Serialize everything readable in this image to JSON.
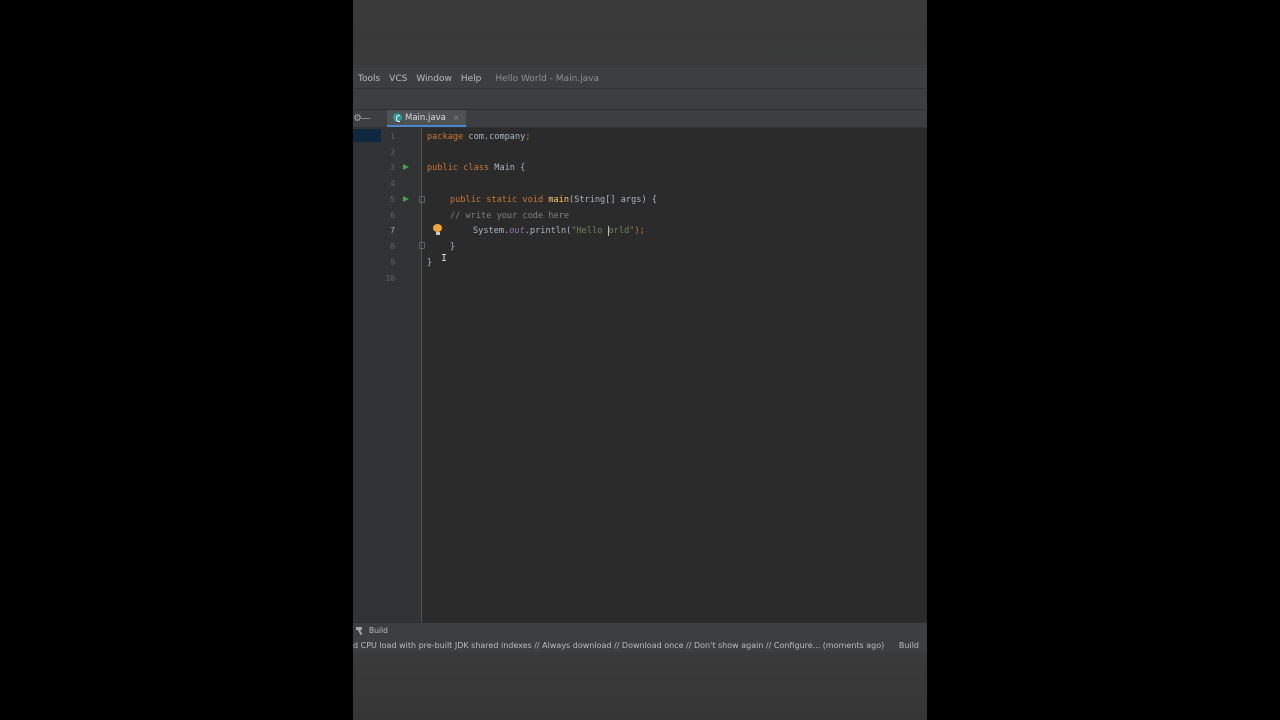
{
  "menu": {
    "items": [
      "Tools",
      "VCS",
      "Window",
      "Help"
    ],
    "window_title": "Hello World - Main.java"
  },
  "tabs": [
    {
      "label": "Main.java",
      "close": "×"
    }
  ],
  "tab_controls": {
    "gear": "⚙",
    "minimize": "—"
  },
  "editor": {
    "line_numbers": [
      "1",
      "2",
      "3",
      "4",
      "5",
      "6",
      "7",
      "8",
      "9",
      "10"
    ],
    "current_line": "7",
    "lines": {
      "l1": {
        "kw": "package ",
        "rest": "com.company",
        "semi": ";"
      },
      "l3": {
        "kw": "public class ",
        "name": "Main",
        "brace": " {"
      },
      "l5": {
        "kw": "public static void ",
        "fn": "main",
        "params": "(String[] args) {"
      },
      "l6": {
        "comment": "// write your code here"
      },
      "l7": {
        "cls": "System.",
        "field": "out",
        "call": ".println(",
        "str_before": "\"Hello ",
        "str_after": "orld\"",
        "end": ");"
      },
      "l8": {
        "text": "}"
      },
      "l9": {
        "text": "}"
      }
    },
    "colors": {
      "keyword": "#cc7832",
      "function": "#ffc66d",
      "string": "#6a8759",
      "comment": "#808080",
      "field": "#9876aa",
      "text": "#a9b7c6"
    }
  },
  "build_tab": {
    "label": "Build"
  },
  "status": {
    "message": "d CPU load with pre-built JDK shared indexes // Always download // Download once // Don't show again // Configure... (moments ago)",
    "right": "Build"
  }
}
